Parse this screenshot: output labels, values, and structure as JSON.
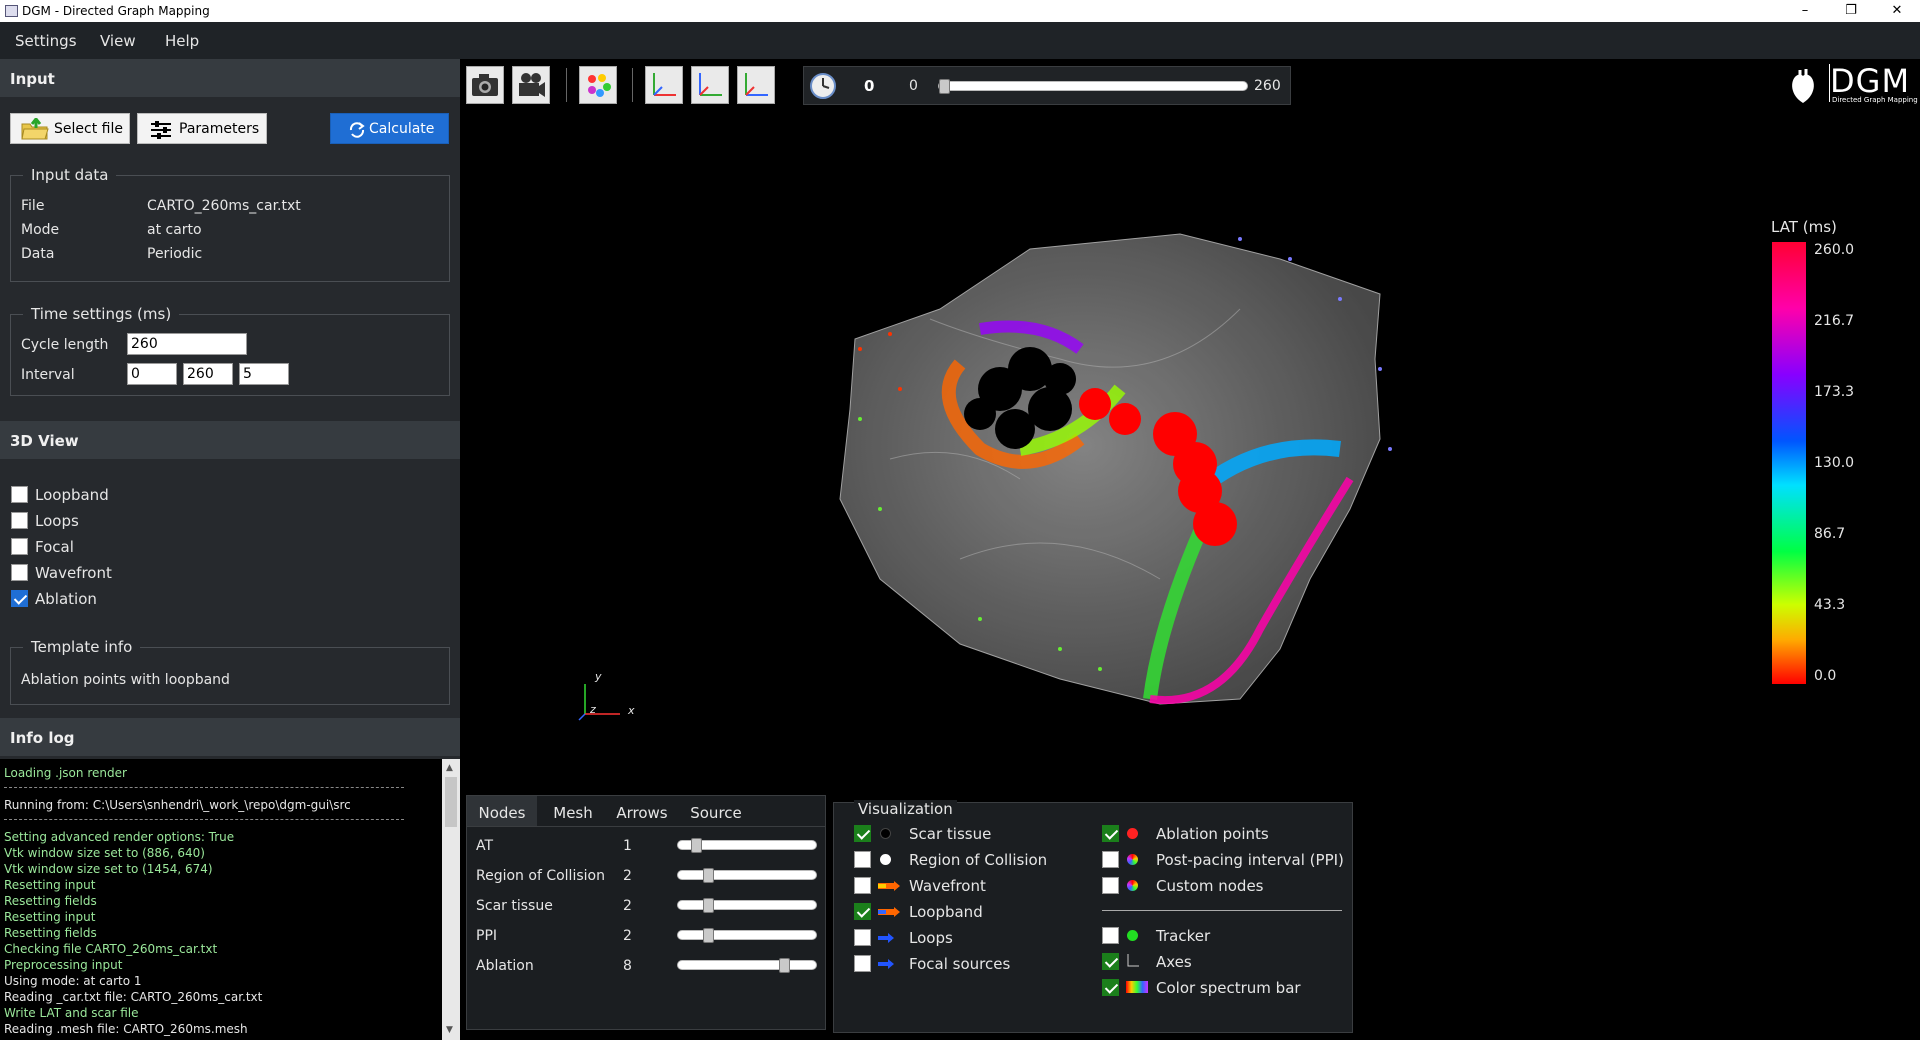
{
  "window": {
    "title": "DGM - Directed Graph Mapping"
  },
  "menu": [
    "Settings",
    "View",
    "Help"
  ],
  "input": {
    "header": "Input",
    "select_file": "Select file",
    "parameters": "Parameters",
    "calculate": "Calculate",
    "input_data_title": "Input data",
    "file_label": "File",
    "file_value": "CARTO_260ms_car.txt",
    "mode_label": "Mode",
    "mode_value": "at carto",
    "data_label": "Data",
    "data_value": "Periodic",
    "time_title": "Time settings (ms)",
    "cycle_label": "Cycle length",
    "cycle_value": "260",
    "interval_label": "Interval",
    "interval_start": "0",
    "interval_end": "260",
    "interval_step": "5"
  },
  "view3d": {
    "header": "3D View",
    "options": [
      {
        "label": "Loopband",
        "checked": false
      },
      {
        "label": "Loops",
        "checked": false
      },
      {
        "label": "Focal",
        "checked": false
      },
      {
        "label": "Wavefront",
        "checked": false
      },
      {
        "label": "Ablation",
        "checked": true
      }
    ],
    "template_title": "Template info",
    "template_text": "Ablation points with loopband"
  },
  "infolog": {
    "header": "Info log",
    "lines": [
      "Loading .json render",
      "Running from: C:\\Users\\snhendri\\_work_\\repo\\dgm-gui\\src",
      "Setting advanced render options: True",
      "Vtk window size set to (886, 640)",
      "Vtk window size set to (1454, 674)",
      "Resetting input",
      "Resetting fields",
      "Resetting input",
      "Resetting fields",
      "Checking file CARTO_260ms_car.txt",
      "Preprocessing input",
      "Using mode: at carto 1",
      "Reading _car.txt file: CARTO_260ms_car.txt",
      "Write LAT and scar file",
      "Reading .mesh file: CARTO_260ms.mesh"
    ]
  },
  "timebar": {
    "current": "0",
    "start": "0",
    "end": "260",
    "progress": 0
  },
  "logo": {
    "title": "DGM",
    "subtitle": "Directed Graph Mapping"
  },
  "axes": {
    "y": "y",
    "z": "z",
    "x": "x"
  },
  "tabs": [
    "Nodes",
    "Mesh",
    "Arrows",
    "Source"
  ],
  "node_sizes": [
    {
      "label": "AT",
      "value": "1",
      "fraction": 0.1
    },
    {
      "label": "Region of Collision",
      "value": "2",
      "fraction": 0.2
    },
    {
      "label": "Scar tissue",
      "value": "2",
      "fraction": 0.2
    },
    {
      "label": "PPI",
      "value": "2",
      "fraction": 0.2
    },
    {
      "label": "Ablation",
      "value": "8",
      "fraction": 0.8
    }
  ],
  "visualization": {
    "title": "Visualization",
    "left": [
      {
        "label": "Scar tissue",
        "checked": true,
        "icon": "black-dot"
      },
      {
        "label": "Region of Collision",
        "checked": false,
        "icon": "white-dot"
      },
      {
        "label": "Wavefront",
        "checked": false,
        "icon": "arrow-multi"
      },
      {
        "label": "Loopband",
        "checked": true,
        "icon": "arrow-multi"
      },
      {
        "label": "Loops",
        "checked": false,
        "icon": "arrow-blue"
      },
      {
        "label": "Focal sources",
        "checked": false,
        "icon": "arrow-blue"
      }
    ],
    "right": [
      {
        "label": "Ablation points",
        "checked": true,
        "icon": "red-dot"
      },
      {
        "label": "Post-pacing interval (PPI)",
        "checked": false,
        "icon": "rainbow-dot"
      },
      {
        "label": "Custom nodes",
        "checked": false,
        "icon": "rainbow-dot"
      }
    ],
    "right2": [
      {
        "label": "Tracker",
        "checked": false,
        "icon": "green-dot"
      },
      {
        "label": "Axes",
        "checked": true,
        "icon": "axes-icon"
      },
      {
        "label": "Color spectrum bar",
        "checked": true,
        "icon": "spectrum-icon"
      }
    ]
  },
  "legend": {
    "title": "LAT (ms)",
    "ticks": [
      "260.0",
      "216.7",
      "173.3",
      "130.0",
      "86.7",
      "43.3",
      "0.0"
    ]
  },
  "colors": {
    "accent": "#1f6ed4",
    "check_green": "#1b7f1b",
    "ablation_red": "#ff0000"
  }
}
